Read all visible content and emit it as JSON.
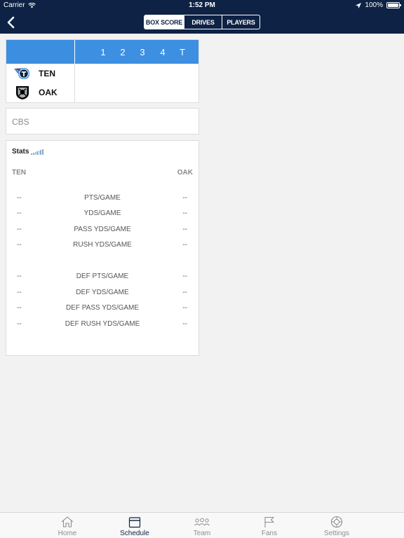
{
  "status_bar": {
    "carrier": "Carrier",
    "time": "1:52 PM",
    "battery": "100%"
  },
  "nav": {
    "segments": [
      {
        "label": "BOX SCORE",
        "active": true
      },
      {
        "label": "DRIVES",
        "active": false
      },
      {
        "label": "PLAYERS",
        "active": false
      }
    ]
  },
  "box_score": {
    "quarters": [
      "1",
      "2",
      "3",
      "4",
      "T"
    ],
    "teams": [
      {
        "abbr": "TEN",
        "logo": "titans-logo-icon"
      },
      {
        "abbr": "OAK",
        "logo": "raiders-logo-icon"
      }
    ]
  },
  "broadcast": {
    "network": "CBS"
  },
  "stats": {
    "title": "Stats",
    "home_label": "TEN",
    "away_label": "OAK",
    "rows": [
      {
        "left": "--",
        "label": "PTS/GAME",
        "right": "--"
      },
      {
        "left": "--",
        "label": "YDS/GAME",
        "right": "--"
      },
      {
        "left": "--",
        "label": "PASS YDS/GAME",
        "right": "--"
      },
      {
        "left": "--",
        "label": "RUSH YDS/GAME",
        "right": "--"
      },
      {
        "left": "--",
        "label": "DEF PTS/GAME",
        "right": "--"
      },
      {
        "left": "--",
        "label": "DEF YDS/GAME",
        "right": "--"
      },
      {
        "left": "--",
        "label": "DEF PASS YDS/GAME",
        "right": "--"
      },
      {
        "left": "--",
        "label": "DEF RUSH YDS/GAME",
        "right": "--"
      }
    ]
  },
  "tab_bar": {
    "items": [
      {
        "label": "Home",
        "icon": "home-icon",
        "active": false
      },
      {
        "label": "Schedule",
        "icon": "calendar-icon",
        "active": true
      },
      {
        "label": "Team",
        "icon": "team-icon",
        "active": false
      },
      {
        "label": "Fans",
        "icon": "flag-icon",
        "active": false
      },
      {
        "label": "Settings",
        "icon": "settings-icon",
        "active": false
      }
    ]
  },
  "colors": {
    "navy": "#0d2244",
    "header_blue": "#3d8fe2",
    "background": "#f2f2f2"
  }
}
